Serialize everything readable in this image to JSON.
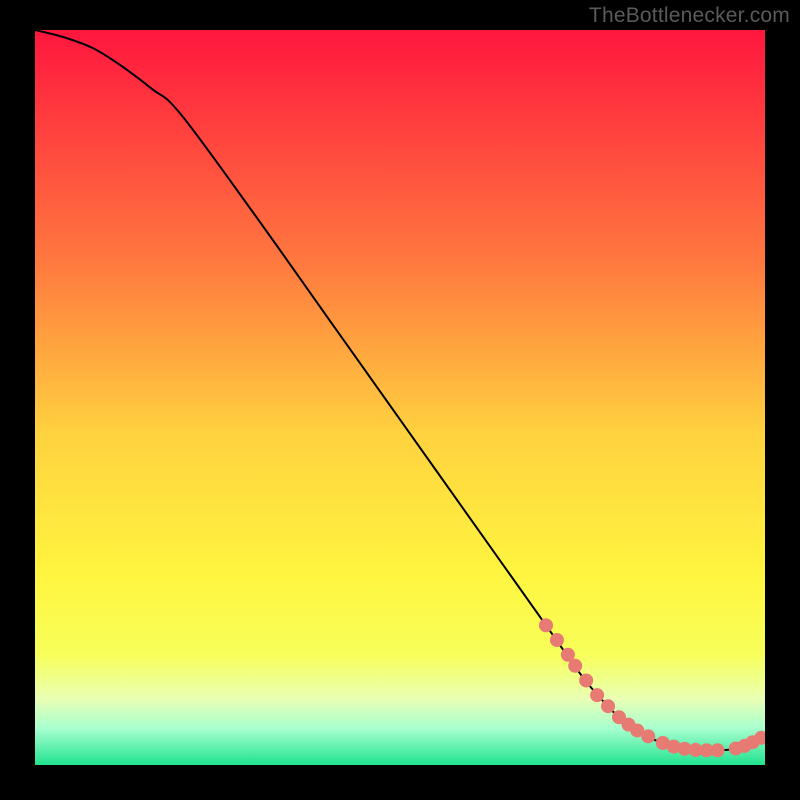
{
  "watermark": "TheBottlenecker.com",
  "colors": {
    "frame_bg": "#000000",
    "watermark": "#5a5a5a",
    "curve": "#000000",
    "marker_fill": "#e77a72",
    "grad_top": "#ff163e",
    "grad_mid1": "#ff7a3f",
    "grad_mid2": "#ffd23f",
    "grad_mid3": "#fff53f",
    "grad_mid4": "#f7ff5a",
    "grad_band1": "#e9ffb4",
    "grad_band2": "#a8ffcf",
    "grad_bottom": "#20e28e"
  },
  "chart_data": {
    "type": "line",
    "title": "",
    "xlabel": "",
    "ylabel": "",
    "xlim": [
      0,
      100
    ],
    "ylim": [
      0,
      100
    ],
    "grid": false,
    "legend": false,
    "series": [
      {
        "name": "curve",
        "x": [
          0,
          4,
          8,
          12,
          16,
          20,
          30,
          40,
          50,
          60,
          70,
          75,
          78,
          80,
          82,
          84,
          86,
          88,
          90,
          92,
          94,
          96,
          98,
          100
        ],
        "y": [
          100,
          99,
          97.5,
          95,
          92,
          88.5,
          75,
          61,
          47,
          33,
          19,
          12,
          8.5,
          6.5,
          5,
          3.8,
          3,
          2.4,
          2.1,
          2.0,
          2.0,
          2.2,
          2.8,
          3.8
        ]
      }
    ],
    "markers": {
      "name": "highlight-points",
      "x": [
        70,
        71.5,
        73,
        74,
        75.5,
        77,
        78.5,
        80,
        81.3,
        82.5,
        84,
        86,
        87.5,
        89,
        90.5,
        92,
        93.5,
        96,
        97.2,
        98.3,
        99.5
      ],
      "y": [
        19,
        17,
        15,
        13.5,
        11.5,
        9.5,
        8,
        6.5,
        5.5,
        4.7,
        3.9,
        3,
        2.5,
        2.2,
        2.05,
        2.0,
        2.0,
        2.25,
        2.6,
        3.1,
        3.7
      ]
    }
  }
}
